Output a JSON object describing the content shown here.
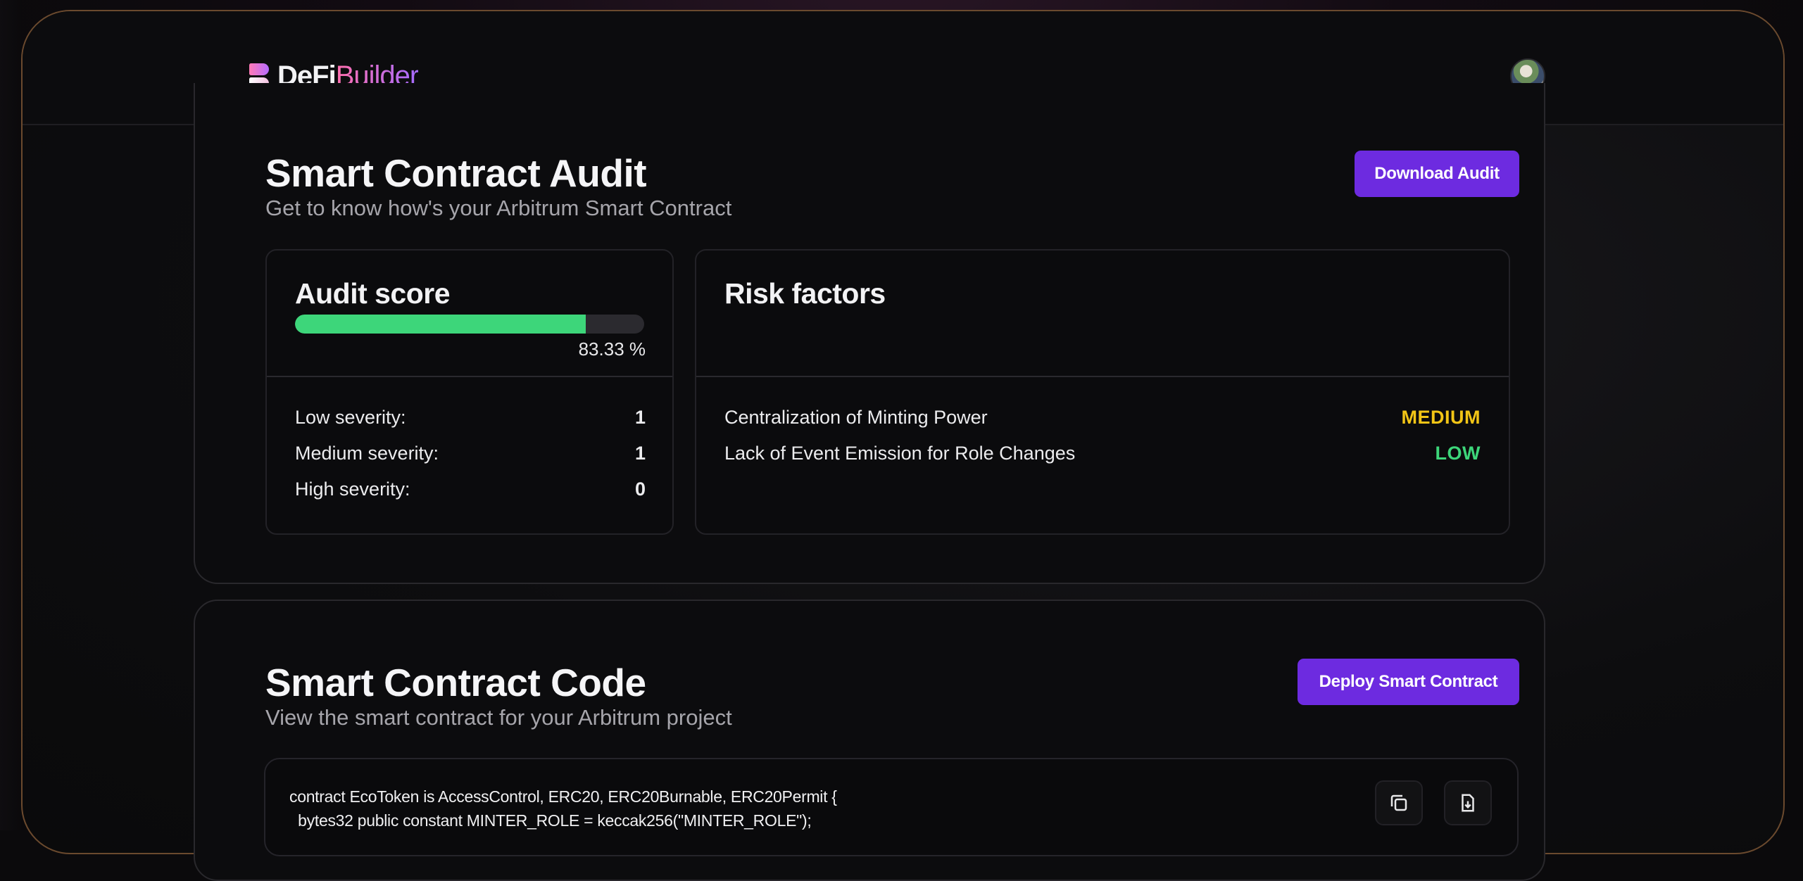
{
  "header": {
    "logo_main": "DeFi",
    "logo_accent": "Builder"
  },
  "audit": {
    "title": "Smart Contract Audit",
    "subtitle": "Get to know how's your Arbitrum Smart Contract",
    "download_label": "Download Audit",
    "score_panel": {
      "title": "Audit score",
      "score_percent": "83.33 %",
      "score_value": 83.33,
      "rows": [
        {
          "label": "Low severity:",
          "value": "1"
        },
        {
          "label": "Medium severity:",
          "value": "1"
        },
        {
          "label": "High severity:",
          "value": "0"
        }
      ]
    },
    "risk_panel": {
      "title": "Risk factors",
      "items": [
        {
          "label": "Centralization of Minting Power",
          "severity": "MEDIUM",
          "color": "#f2c516"
        },
        {
          "label": "Lack of Event Emission for Role Changes",
          "severity": "LOW",
          "color": "#3dd67a"
        }
      ]
    }
  },
  "code": {
    "title": "Smart Contract Code",
    "subtitle": "View the smart contract for your Arbitrum project",
    "deploy_label": "Deploy Smart Contract",
    "lines": [
      "contract EcoToken is AccessControl, ERC20, ERC20Burnable, ERC20Permit {",
      "  bytes32 public constant MINTER_ROLE = keccak256(\"MINTER_ROLE\");"
    ]
  },
  "colors": {
    "accent": "#6d2be0",
    "progress": "#3dd67a",
    "medium": "#f2c516",
    "low": "#3dd67a"
  },
  "icons": [
    "copy-icon",
    "download-file-icon"
  ]
}
